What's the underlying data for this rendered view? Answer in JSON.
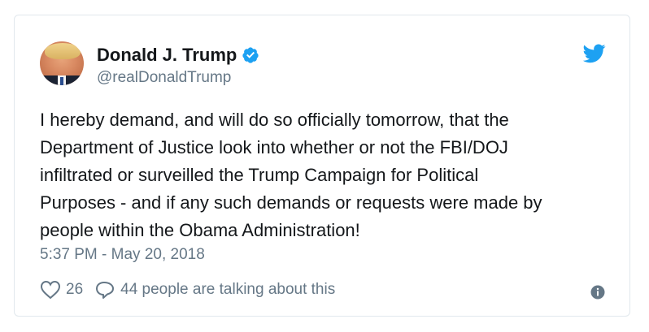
{
  "tweet": {
    "author_name": "Donald J. Trump",
    "handle": "@realDonaldTrump",
    "verified": true,
    "text": "I hereby demand, and will do so officially tomorrow, that the\nDepartment of Justice look into whether or not the FBI/DOJ\ninfiltrated or surveilled the Trump Campaign for Political\nPurposes - and if any such demands or requests were made by\npeople within the Obama Administration!",
    "timestamp": "5:37 PM - May 20, 2018",
    "likes": "26",
    "talking": "44 people are talking about this"
  },
  "icons": {
    "avatar": "profile-photo",
    "verified": "verified-badge-icon",
    "brand": "twitter-bird-icon",
    "like": "heart-icon",
    "reply": "speech-bubble-icon",
    "info": "info-icon"
  },
  "colors": {
    "brand": "#1da1f2",
    "text": "#14171a",
    "secondary": "#657786",
    "border": "#e1e8ed"
  }
}
